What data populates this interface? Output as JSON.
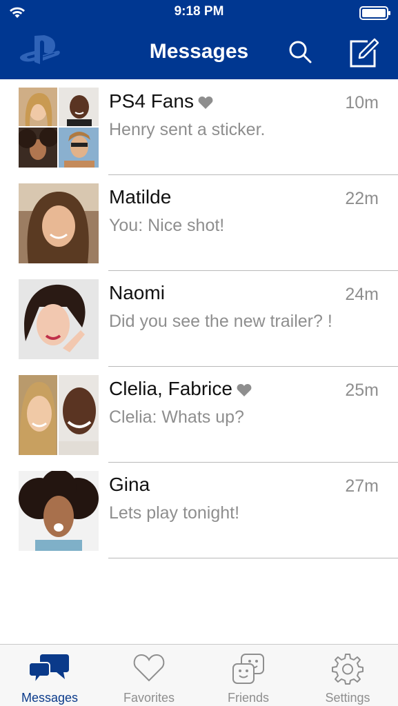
{
  "status_bar": {
    "time": "9:18 PM"
  },
  "nav": {
    "title": "Messages"
  },
  "conversations": [
    {
      "name": "PS4 Fans",
      "favorite": true,
      "time": "10m",
      "preview": "Henry sent a sticker."
    },
    {
      "name": "Matilde",
      "favorite": false,
      "time": "22m",
      "preview": "You: Nice shot!"
    },
    {
      "name": "Naomi",
      "favorite": false,
      "time": "24m",
      "preview": "Did you see the new trailer? !"
    },
    {
      "name": "Clelia, Fabrice",
      "favorite": true,
      "time": "25m",
      "preview": "Clelia: Whats up?"
    },
    {
      "name": "Gina",
      "favorite": false,
      "time": "27m",
      "preview": "Lets play tonight!"
    }
  ],
  "tabs": [
    {
      "label": "Messages",
      "icon": "chat-bubbles-icon",
      "active": true
    },
    {
      "label": "Favorites",
      "icon": "heart-icon",
      "active": false
    },
    {
      "label": "Friends",
      "icon": "friends-faces-icon",
      "active": false
    },
    {
      "label": "Settings",
      "icon": "gear-icon",
      "active": false
    }
  ],
  "colors": {
    "header": "#003791",
    "active_tab": "#0a3a8a",
    "secondary_text": "#8e8e8e"
  }
}
